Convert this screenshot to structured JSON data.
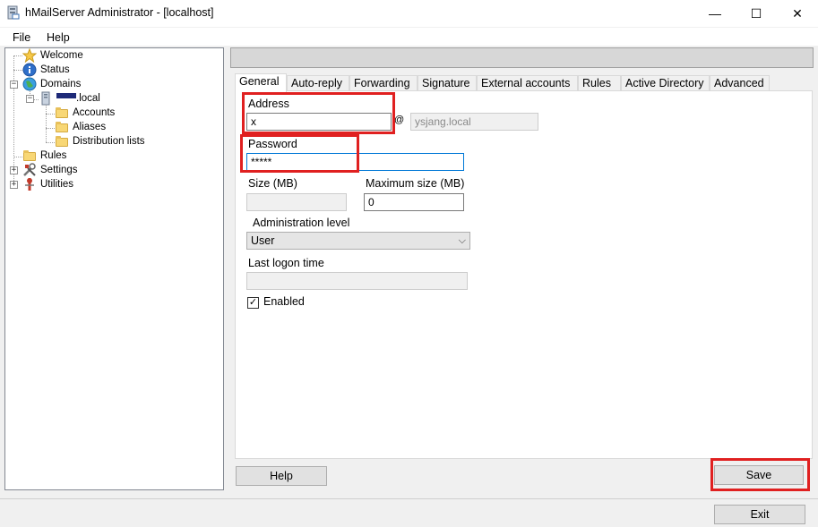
{
  "window": {
    "title": "hMailServer Administrator - [localhost]",
    "minimize": "—",
    "maximize": "☐",
    "close": "✕"
  },
  "menu": {
    "file": "File",
    "help": "Help"
  },
  "tree": {
    "welcome": "Welcome",
    "status": "Status",
    "domains": "Domains",
    "domain_name": ".local",
    "accounts": "Accounts",
    "aliases": "Aliases",
    "distribution_lists": "Distribution lists",
    "rules": "Rules",
    "settings": "Settings",
    "utilities": "Utilities"
  },
  "tabs": [
    "General",
    "Auto-reply",
    "Forwarding",
    "Signature",
    "External accounts",
    "Rules",
    "Active Directory",
    "Advanced"
  ],
  "form": {
    "address_label": "Address",
    "address_value": "x",
    "at_sign": "@",
    "domain_value": "ysjang.local",
    "password_label": "Password",
    "password_value": "*****",
    "size_label": "Size (MB)",
    "size_value": "",
    "max_size_label": "Maximum size (MB)",
    "max_size_value": "0",
    "admin_level_label": "Administration level",
    "admin_level_value": "User",
    "last_logon_label": "Last logon time",
    "last_logon_value": "",
    "enabled_label": "Enabled",
    "enabled_checked": true
  },
  "buttons": {
    "help": "Help",
    "save": "Save",
    "exit": "Exit"
  },
  "colors": {
    "highlight": "#e02020",
    "focus": "#0078d7"
  }
}
